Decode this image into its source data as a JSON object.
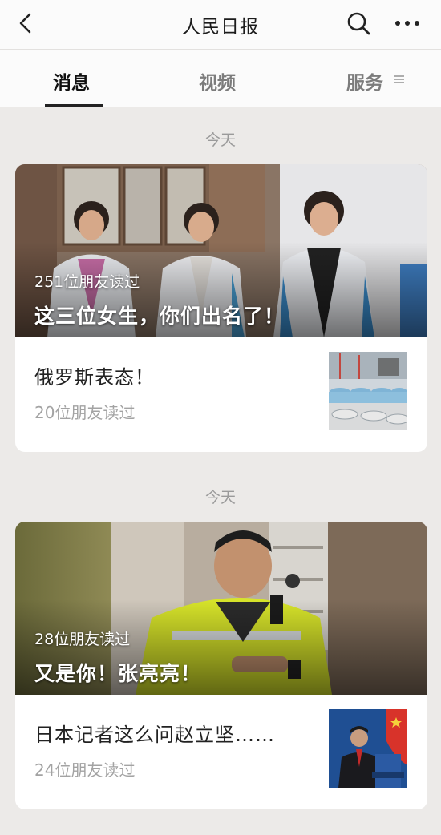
{
  "header": {
    "title": "人民日报",
    "back_icon": "chevron-left-icon",
    "search_icon": "search-icon",
    "more_icon": "more-horizontal-icon"
  },
  "tabs": [
    {
      "label": "消息",
      "active": true
    },
    {
      "label": "视频",
      "active": false
    },
    {
      "label": "服务",
      "active": false
    }
  ],
  "feed": [
    {
      "date": "今天",
      "hero": {
        "reads": "251位朋友读过",
        "title": "这三位女生，你们出名了！"
      },
      "sub": {
        "title": "俄罗斯表态！",
        "reads": "20位朋友读过"
      }
    },
    {
      "date": "今天",
      "hero": {
        "reads": "28位朋友读过",
        "title": "又是你！张亮亮！"
      },
      "sub": {
        "title": "日本记者这么问赵立坚……",
        "reads": "24位朋友读过"
      }
    }
  ],
  "colors": {
    "background": "#eceae8",
    "card": "#ffffff",
    "secondary_text": "#a3a3a3",
    "tab_inactive": "#7c7c7c"
  }
}
